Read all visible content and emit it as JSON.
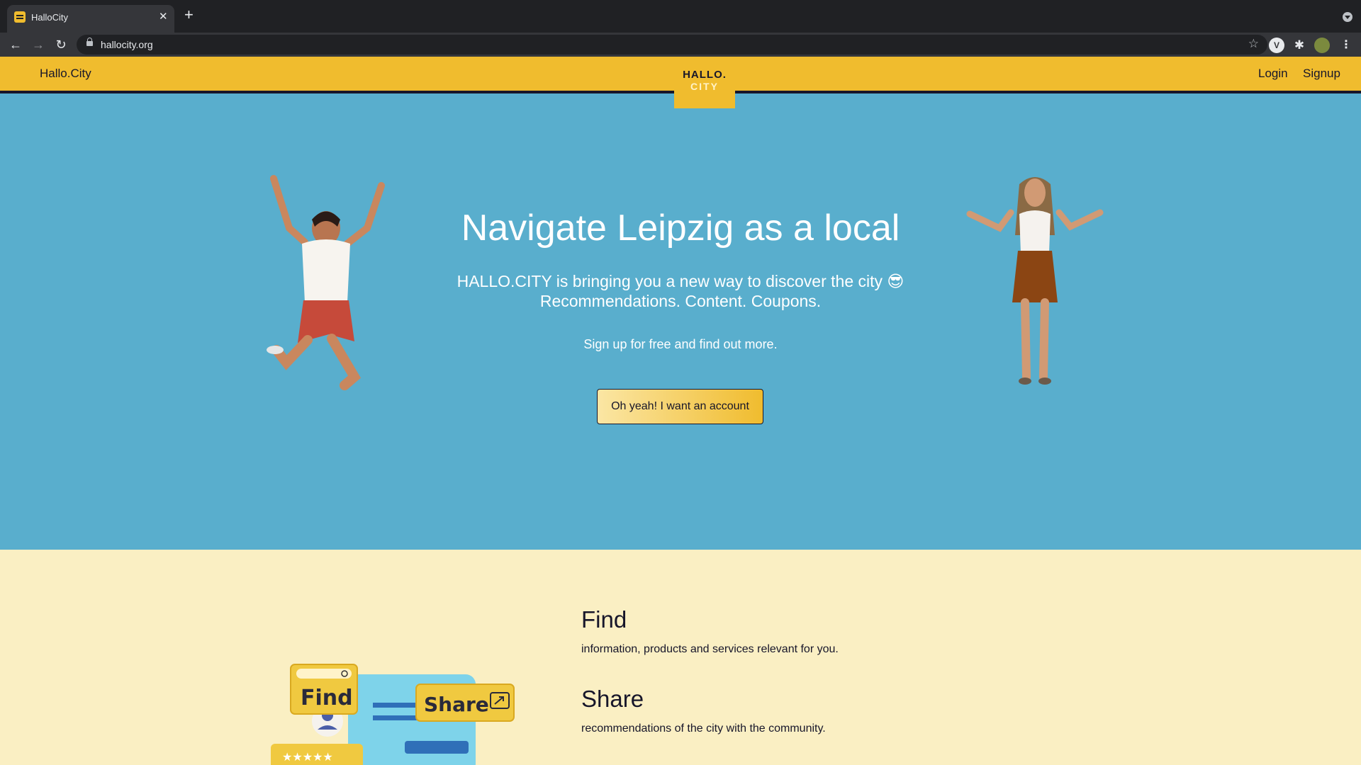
{
  "browser": {
    "tab_title": "HalloCity",
    "tab_close": "✕",
    "new_tab": "+",
    "url": "hallocity.org",
    "ext_v_label": "V",
    "icons": [
      "back-icon",
      "forward-icon",
      "reload-icon",
      "lock-icon",
      "star-icon",
      "puzzle-icon",
      "menu-icon"
    ]
  },
  "nav": {
    "brand": "Hallo.City",
    "logo_top": "HALLO.",
    "logo_bottom": "CITY",
    "login": "Login",
    "signup": "Signup"
  },
  "hero": {
    "title": "Navigate Leipzig as a local",
    "line1": "HALLO.CITY is bringing you a new way to discover the city 😎",
    "line2": "Recommendations. Content. Coupons.",
    "small": "Sign up for free and find out more.",
    "cta": "Oh yeah! I want an account"
  },
  "features": {
    "find_title": "Find",
    "find_text": "information, products and services relevant for you.",
    "share_title": "Share",
    "share_text": "recommendations of the city with the community.",
    "illustration_find": "Find",
    "illustration_share": "Share"
  },
  "colors": {
    "nav_yellow": "#f0bc2e",
    "hero_blue": "#59aecd",
    "cream": "#faefc3",
    "ink": "#17162a"
  }
}
